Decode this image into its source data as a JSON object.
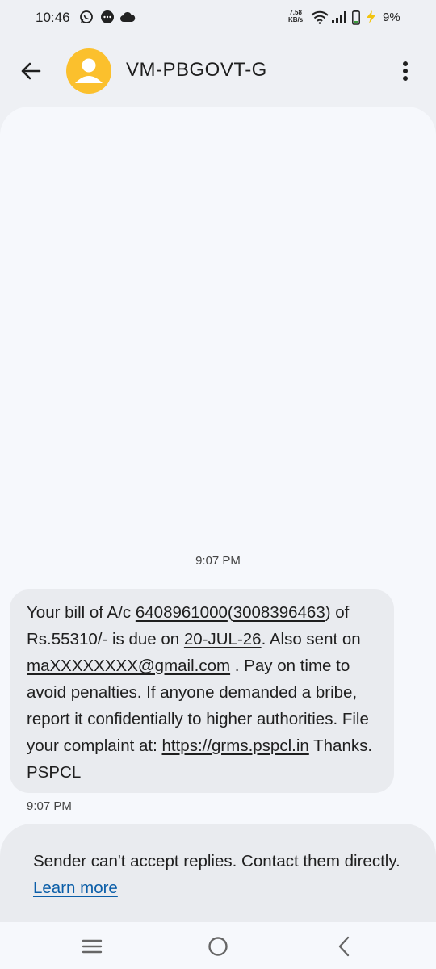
{
  "status_bar": {
    "time": "10:46",
    "net_speed_value": "7.58",
    "net_speed_unit": "KB/s",
    "battery": "9%",
    "icons": [
      "whatsapp-icon",
      "message-icon",
      "cloud-icon",
      "wifi-icon",
      "signal-icon",
      "battery-saver-icon"
    ]
  },
  "header": {
    "title": "VM-PBGOVT-G",
    "avatar_color": "#fbc02d",
    "icons": [
      "back-arrow-icon",
      "person-icon",
      "more-vert-icon"
    ]
  },
  "conversation": {
    "timestamp_top": "9:07 PM",
    "message": {
      "t1": "Your bill of A/c ",
      "account": "6408961000",
      "t2": "(",
      "account2": "3008396463",
      "t3": ") of Rs.55310/- is due on ",
      "due_date": "20-JUL-26",
      "t4": ". Also sent on ",
      "email": "maXXXXXXXX@gmail.com",
      "t5": " . Pay on time to avoid penalties. If anyone demanded a bribe, report it confidentially to higher authorities. File your complaint at: ",
      "url": "https://grms.pspcl.in",
      "t6": " Thanks. PSPCL"
    },
    "timestamp_bottom": "9:07 PM"
  },
  "notice": {
    "text": "Sender can't accept replies. Contact them directly. ",
    "learn_more": "Learn more",
    "link_color": "#0b5ea8"
  },
  "nav_bar": {
    "icons": [
      "recents-icon",
      "home-icon",
      "back-icon"
    ]
  }
}
